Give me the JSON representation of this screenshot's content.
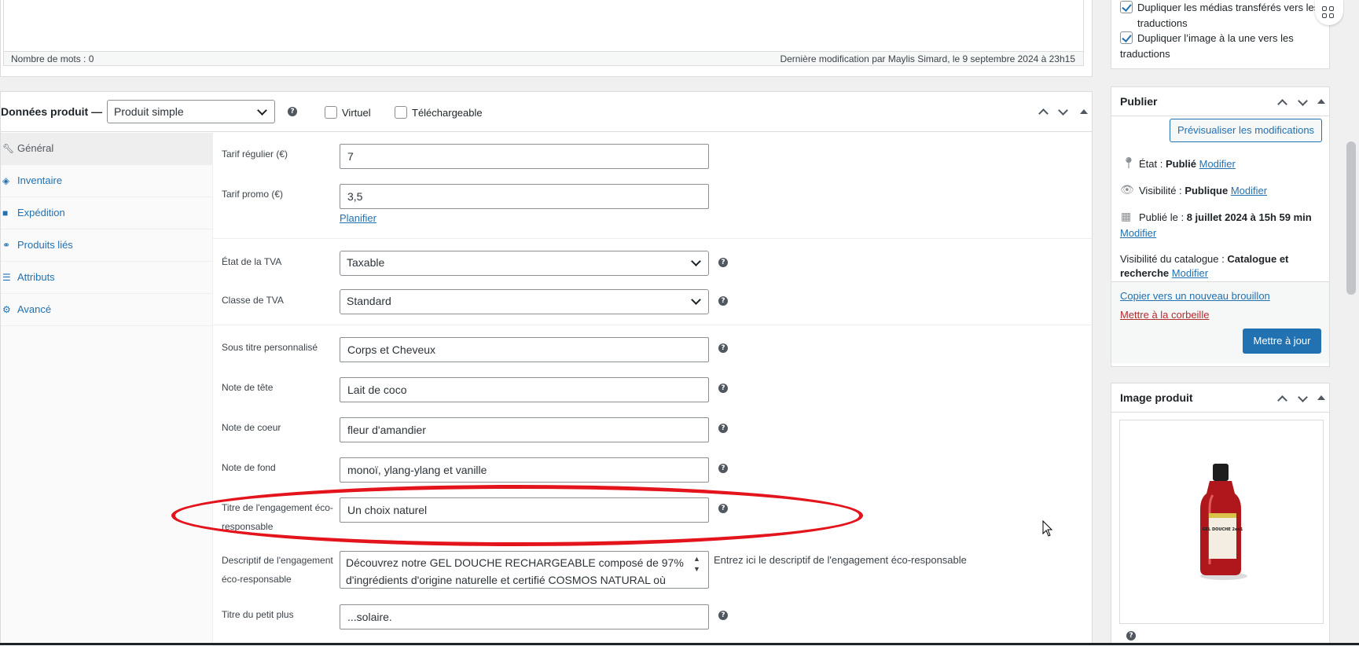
{
  "editor": {
    "word_count": "Nombre de mots : 0",
    "last_modified": "Dernière modification par Maylis Simard, le 9 septembre 2024 à 23h15"
  },
  "translation_options": {
    "dup_media": "Dupliquer les médias transférés vers les traductions",
    "dup_featured": "Dupliquer l’image à la une vers les traductions"
  },
  "product_data": {
    "title": "Données produit —",
    "type_select": "Produit simple",
    "virtual_label": "Virtuel",
    "downloadable_label": "Téléchargeable",
    "tabs": [
      {
        "label": "Général"
      },
      {
        "label": "Inventaire"
      },
      {
        "label": "Expédition"
      },
      {
        "label": "Produits liés"
      },
      {
        "label": "Attributs"
      },
      {
        "label": "Avancé"
      }
    ],
    "regular_price": {
      "label": "Tarif régulier (€)",
      "value": "7"
    },
    "sale_price": {
      "label": "Tarif promo (€)",
      "value": "3,5",
      "schedule_link": "Planifier"
    },
    "tax_status": {
      "label": "État de la TVA",
      "value": "Taxable"
    },
    "tax_class": {
      "label": "Classe de TVA",
      "value": "Standard"
    },
    "subtitle": {
      "label": "Sous titre personnalisé",
      "value": "Corps et Cheveux"
    },
    "top_note": {
      "label": "Note de tête",
      "value": "Lait de coco"
    },
    "heart_note": {
      "label": "Note de coeur",
      "value": "fleur d'amandier"
    },
    "base_note": {
      "label": "Note de fond",
      "value": "monoï, ylang-ylang et vanille"
    },
    "eco_title": {
      "label": "Titre de l'engagement éco-responsable",
      "value": "Un choix naturel"
    },
    "eco_desc": {
      "label": "Descriptif de l'engagement éco-responsable",
      "value": "Découvrez notre GEL DOUCHE RECHARGEABLE composé de 97% d'ingrédients d'origine naturelle et certifié COSMOS NATURAL où",
      "hint": "Entrez ici le descriptif de l'engagement éco-responsable"
    },
    "extra_title": {
      "label": "Titre du petit plus",
      "value": "...solaire."
    }
  },
  "publish": {
    "title": "Publier",
    "preview_button": "Prévisualiser les modifications",
    "status_label": "État :",
    "status_value": "Publié",
    "visibility_label": "Visibilité :",
    "visibility_value": "Publique",
    "published_label": "Publié le :",
    "published_value": "8 juillet 2024 à 15h 59 min",
    "catalog_label": "Visibilité du catalogue :",
    "catalog_value": "Catalogue et recherche",
    "modify": "Modifier",
    "copy_draft": "Copier vers un nouveau brouillon",
    "trash": "Mettre à la corbeille",
    "update_button": "Mettre à jour"
  },
  "product_image": {
    "title": "Image produit",
    "bottle_label_line1": "GEL DOUCHE 2en1"
  },
  "colors": {
    "primary": "#2271b1",
    "trash": "#b32d2e",
    "annotation": "#e3141c"
  }
}
